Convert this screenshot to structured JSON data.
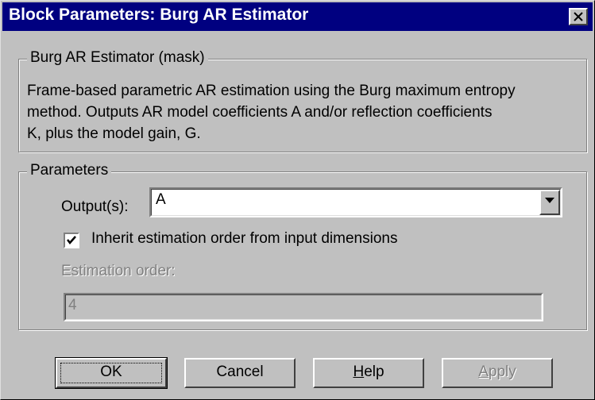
{
  "window": {
    "title": "Block Parameters: Burg AR Estimator"
  },
  "description_group": {
    "legend": "Burg AR Estimator (mask)",
    "lines": [
      "Frame-based parametric AR estimation using the Burg maximum entropy",
      "method.  Outputs AR model coefficients A and/or reflection coefficients",
      "K, plus the model gain, G."
    ]
  },
  "parameters_group": {
    "legend": "Parameters",
    "output_label": "Output(s):",
    "output_value": "A",
    "inherit_checkbox_label": "Inherit estimation order from input dimensions",
    "inherit_checked": true,
    "estimation_order_label": "Estimation order:",
    "estimation_order_value": "4"
  },
  "buttons": {
    "ok": "OK",
    "cancel": "Cancel",
    "help_mnemonic": "H",
    "help_rest": "elp",
    "apply_mnemonic": "A",
    "apply_rest": "pply"
  },
  "colors": {
    "titlebar": "#000080",
    "face": "#c0c0c0",
    "disabled_text": "#808080"
  }
}
